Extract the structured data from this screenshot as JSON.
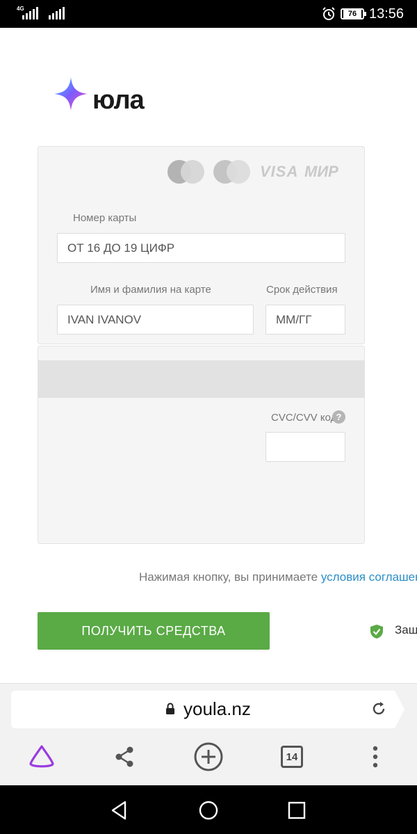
{
  "status_bar": {
    "network": "4G",
    "battery": "76",
    "time": "13:56",
    "icons": [
      "signal-icon",
      "signal-icon",
      "alarm-icon",
      "battery-icon"
    ]
  },
  "brand": {
    "name": "юла",
    "logo_icon": "star-sparkle-icon",
    "colors": {
      "accent_start": "#3ec6ff",
      "accent_mid": "#7b5cff",
      "accent_end": "#ff4fb3"
    }
  },
  "payment_logos": [
    "mastercard-icon",
    "maestro-icon",
    "VISA",
    "МИР"
  ],
  "card_form": {
    "card_number": {
      "label": "Номер карты",
      "placeholder": "ОТ 16 ДО 19 ЦИФР"
    },
    "holder_name": {
      "label": "Имя и фамилия на карте",
      "placeholder": "IVAN IVANOV"
    },
    "expiry": {
      "label": "Срок действия",
      "placeholder": "ММ/ГГ"
    },
    "cvc": {
      "label": "CVC/CVV код",
      "help": "?",
      "value": ""
    }
  },
  "terms": {
    "text": "Нажимая кнопку, вы принимаете ",
    "link": "условия соглашения"
  },
  "submit": {
    "label": "ПОЛУЧИТЬ СРЕДСТВА",
    "color": "#5aaa46"
  },
  "secure": {
    "label": "Защищено"
  },
  "browser": {
    "url": "youla.nz",
    "tabs_count": "14",
    "toolbar_icons": [
      "alice-icon",
      "share-icon",
      "new-tab-icon",
      "tabs-icon",
      "more-icon"
    ]
  },
  "system_nav": [
    "back-icon",
    "home-icon",
    "recents-icon"
  ]
}
